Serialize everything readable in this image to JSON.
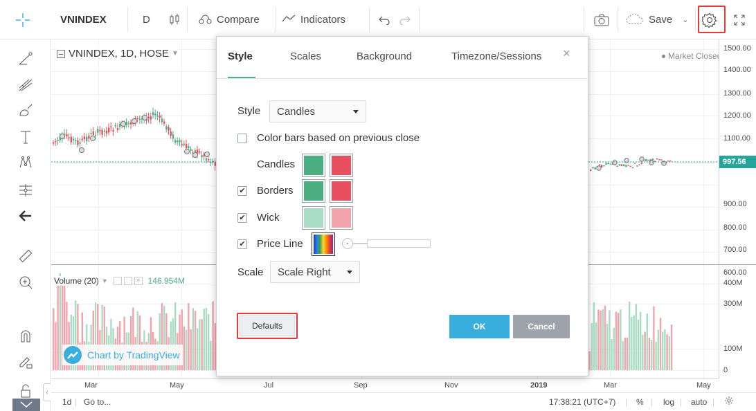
{
  "topbar": {
    "symbol": "VNINDEX",
    "interval": "D",
    "compare_label": "Compare",
    "indicators_label": "Indicators",
    "save_label": "Save"
  },
  "legend": {
    "title": "VNINDEX, 1D, HOSE",
    "market_status": "Market Closed",
    "volume_title": "Volume (20)",
    "volume_value": "146.954M"
  },
  "price_axis": {
    "labels": [
      "1500.00",
      "1400.00",
      "1300.00",
      "1200.00",
      "1100.00",
      "900.00",
      "800.00",
      "700.00",
      "600.00"
    ],
    "last_price": "997.56"
  },
  "volume_axis": {
    "labels": [
      "400M",
      "300M",
      "100M",
      "0"
    ]
  },
  "time_axis": {
    "labels": [
      "Mar",
      "May",
      "Jul",
      "Sep",
      "Nov",
      "2019",
      "Mar",
      "May"
    ]
  },
  "bottombar": {
    "range": "1d",
    "goto": "Go to...",
    "clock": "17:38:21 (UTC+7)",
    "percent": "%",
    "log": "log",
    "auto": "auto"
  },
  "watermark": "Chart by TradingView",
  "colors": {
    "up": "#4caf82",
    "down": "#e9505f",
    "up_wick": "#a8dcc3",
    "down_wick": "#f3a3ab",
    "accent": "#39afe0",
    "price_line": "#26a69a"
  },
  "dialog": {
    "tabs": [
      "Style",
      "Scales",
      "Background",
      "Timezone/Sessions"
    ],
    "active_tab": "Style",
    "style_label": "Style",
    "style_value": "Candles",
    "color_bars_label": "Color bars based on previous close",
    "candles_label": "Candles",
    "borders_label": "Borders",
    "wick_label": "Wick",
    "price_line_label": "Price Line",
    "scale_label": "Scale",
    "scale_value": "Scale Right",
    "defaults_label": "Defaults",
    "ok_label": "OK",
    "cancel_label": "Cancel",
    "color_bars_checked": false,
    "borders_checked": true,
    "wick_checked": true,
    "price_line_checked": true
  }
}
